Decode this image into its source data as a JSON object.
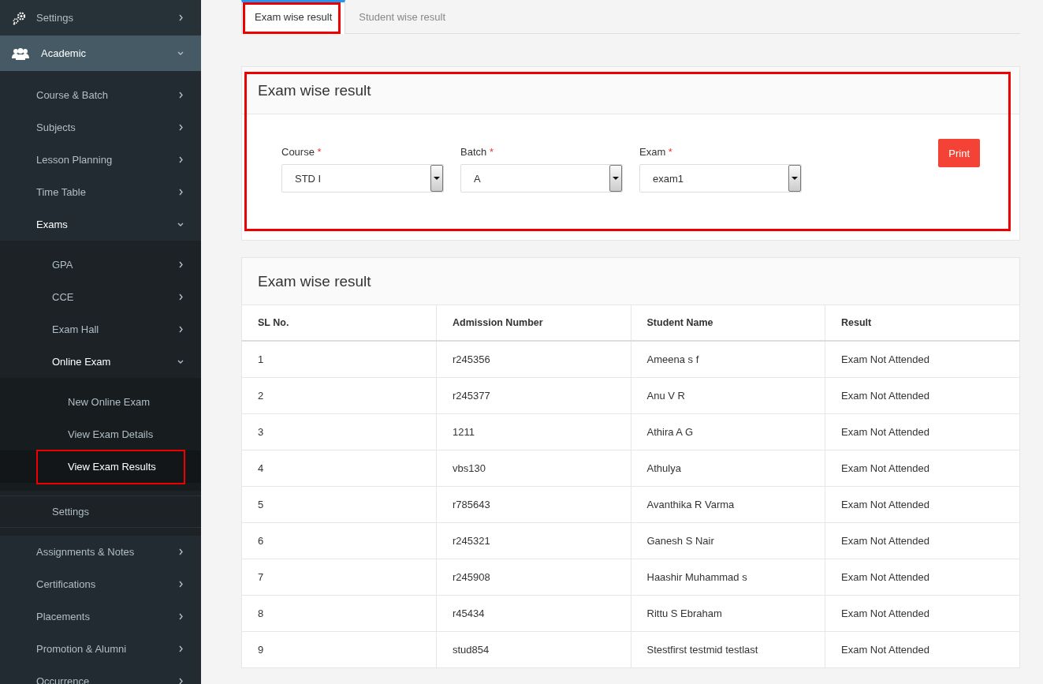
{
  "sidebar": {
    "items": [
      {
        "label": "Settings",
        "expanded": false,
        "selected": false,
        "highlighted": false
      },
      {
        "label": "Academic",
        "expanded": true,
        "selected": false,
        "highlighted": false,
        "children": [
          {
            "label": "Course & Batch",
            "expanded": false,
            "selected": false,
            "highlighted": false
          },
          {
            "label": "Subjects",
            "expanded": false,
            "selected": false,
            "highlighted": false
          },
          {
            "label": "Lesson Planning",
            "expanded": false,
            "selected": false,
            "highlighted": false
          },
          {
            "label": "Time Table",
            "expanded": false,
            "selected": false,
            "highlighted": false
          },
          {
            "label": "Exams",
            "expanded": true,
            "selected": false,
            "highlighted": false,
            "children": [
              {
                "label": "GPA",
                "expanded": false,
                "selected": false,
                "highlighted": false
              },
              {
                "label": "CCE",
                "expanded": false,
                "selected": false,
                "highlighted": false
              },
              {
                "label": "Exam Hall",
                "expanded": false,
                "selected": false,
                "highlighted": false
              },
              {
                "label": "Online Exam",
                "expanded": true,
                "selected": false,
                "highlighted": false,
                "children": [
                  {
                    "label": "New Online Exam",
                    "selected": false,
                    "highlighted": false
                  },
                  {
                    "label": "View Exam Details",
                    "selected": false,
                    "highlighted": false
                  },
                  {
                    "label": "View Exam Results",
                    "selected": true,
                    "highlighted": true
                  }
                ]
              },
              {
                "label": "Settings",
                "selected": false,
                "highlighted": false
              }
            ]
          },
          {
            "label": "Assignments & Notes",
            "expanded": false,
            "selected": false,
            "highlighted": false
          },
          {
            "label": "Certifications",
            "expanded": false,
            "selected": false,
            "highlighted": false
          },
          {
            "label": "Placements",
            "expanded": false,
            "selected": false,
            "highlighted": false
          },
          {
            "label": "Promotion & Alumni",
            "expanded": false,
            "selected": false,
            "highlighted": false
          },
          {
            "label": "Occurrence",
            "expanded": false,
            "selected": false,
            "highlighted": false
          }
        ]
      }
    ]
  },
  "tabs": [
    {
      "label": "Exam wise result",
      "selected": true,
      "highlighted": true
    },
    {
      "label": "Student wise result",
      "selected": false,
      "highlighted": false
    }
  ],
  "filter_card": {
    "title": "Exam wise result",
    "highlighted": true,
    "fields": [
      {
        "label": "Course",
        "required_mark": "*",
        "value": "STD I"
      },
      {
        "label": "Batch",
        "required_mark": "*",
        "value": "A"
      },
      {
        "label": "Exam",
        "required_mark": "*",
        "value": "exam1"
      }
    ],
    "print_button": "Print"
  },
  "results_table": {
    "title": "Exam wise result",
    "columns": [
      "SL No.",
      "Admission Number",
      "Student Name",
      "Result"
    ],
    "rows": [
      [
        "1",
        "r245356",
        "Ameena s f",
        "Exam Not Attended"
      ],
      [
        "2",
        "r245377",
        "Anu V R",
        "Exam Not Attended"
      ],
      [
        "3",
        "1211",
        "Athira A G",
        "Exam Not Attended"
      ],
      [
        "4",
        "vbs130",
        "Athulya",
        "Exam Not Attended"
      ],
      [
        "5",
        "r785643",
        "Avanthika R Varma",
        "Exam Not Attended"
      ],
      [
        "6",
        "r245321",
        "Ganesh S Nair",
        "Exam Not Attended"
      ],
      [
        "7",
        "r245908",
        "Haashir Muhammad s",
        "Exam Not Attended"
      ],
      [
        "8",
        "r45434",
        "Rittu S Ebraham",
        "Exam Not Attended"
      ],
      [
        "9",
        "stud854",
        "Stestfirst testmid testlast",
        "Exam Not Attended"
      ]
    ]
  }
}
